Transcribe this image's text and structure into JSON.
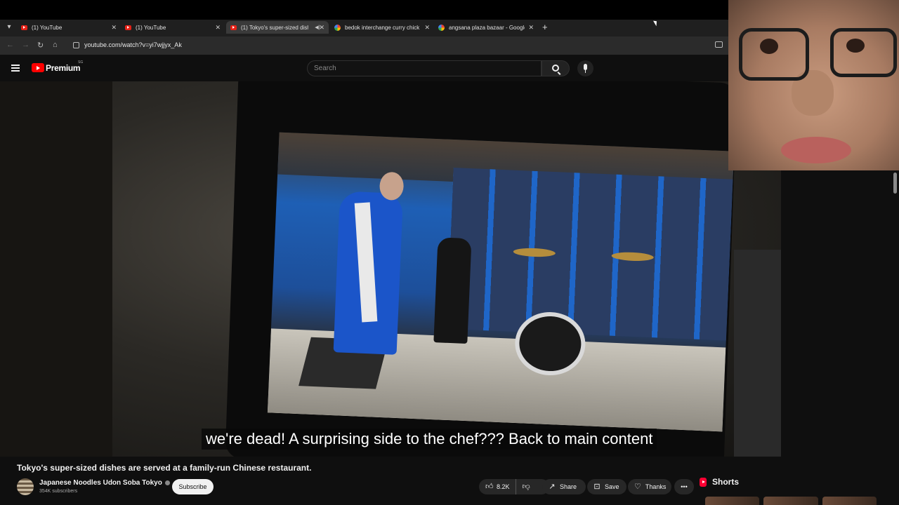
{
  "browser": {
    "tabs": [
      {
        "title": "(1) YouTube",
        "favicon": "youtube-icon"
      },
      {
        "title": "(1) YouTube",
        "favicon": "youtube-icon"
      },
      {
        "title": "(1) Tokyo's super-sized dish",
        "favicon": "youtube-icon",
        "active": true
      },
      {
        "title": "bedok interchange curry chick",
        "favicon": "google-icon"
      },
      {
        "title": "angsana plaza bazaar - Google",
        "favicon": "google-icon"
      }
    ],
    "url": "youtube.com/watch?v=yi7wjjyx_Ak"
  },
  "header": {
    "brand": "Premium",
    "country": "SG",
    "search_placeholder": "Search"
  },
  "video": {
    "caption": "we're dead! A surprising side to the chef??? Back to main content",
    "title": "Tokyo's super-sized dishes are served at a family-run Chinese restaurant."
  },
  "channel": {
    "name": "Japanese Noodles Udon Soba Tokyo",
    "subscribers": "354K subscribers",
    "subscribe_label": "Subscribe"
  },
  "actions": {
    "likes": "8.2K",
    "share": "Share",
    "save": "Save",
    "thanks": "Thanks"
  },
  "sidebar": {
    "shorts_label": "Shorts"
  },
  "colors": {
    "accent": "#ff0000",
    "background": "#0f0f0f",
    "pill": "#272727"
  }
}
